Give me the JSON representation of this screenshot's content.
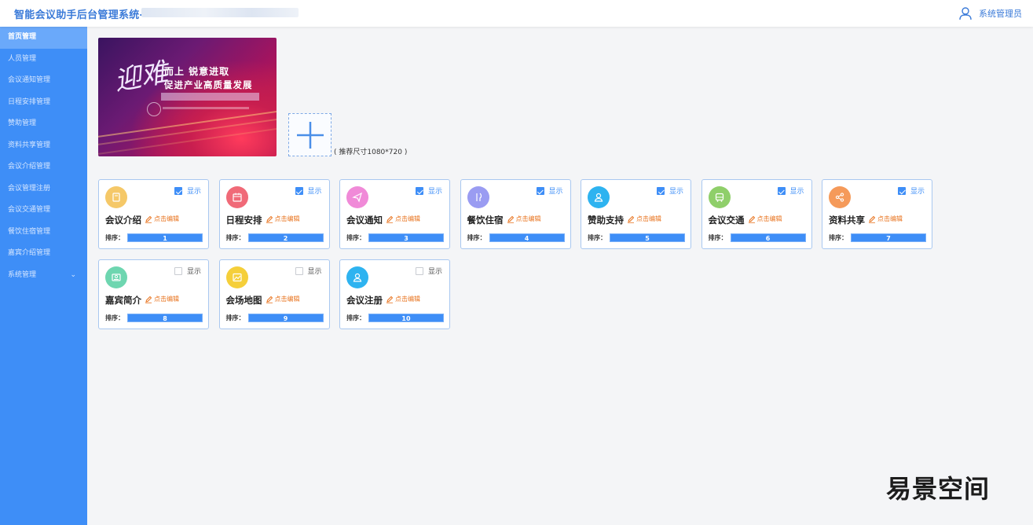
{
  "header": {
    "app_title": "智能会议助手后台管理系统---",
    "user_name": "系统管理员"
  },
  "sidebar": {
    "items": [
      {
        "label": "首页管理",
        "active": true
      },
      {
        "label": "人员管理"
      },
      {
        "label": "会议通知管理"
      },
      {
        "label": "日程安排管理"
      },
      {
        "label": "赞助管理"
      },
      {
        "label": "资料共享管理"
      },
      {
        "label": "会议介绍管理"
      },
      {
        "label": "会议管理注册"
      },
      {
        "label": "会议交通管理"
      },
      {
        "label": "餐饮住宿管理"
      },
      {
        "label": "嘉宾介绍管理"
      },
      {
        "label": "系统管理",
        "has_children": true
      }
    ]
  },
  "banner": {
    "big_char": "迎难",
    "line1": "而上  锐意进取",
    "line2": "促进产业高质量发展"
  },
  "upload": {
    "hint": "( 推荐尺寸1080*720 )"
  },
  "cards": [
    {
      "title": "会议介绍",
      "show_label": "显示",
      "checked": true,
      "edit_label": "点击编辑",
      "sort_label": "排序：",
      "sort": "1",
      "icon": "book-icon",
      "color": "#f5c868"
    },
    {
      "title": "日程安排",
      "show_label": "显示",
      "checked": true,
      "edit_label": "点击编辑",
      "sort_label": "排序：",
      "sort": "2",
      "icon": "calendar-icon",
      "color": "#f06a78"
    },
    {
      "title": "会议通知",
      "show_label": "显示",
      "checked": true,
      "edit_label": "点击编辑",
      "sort_label": "排序：",
      "sort": "3",
      "icon": "send-icon",
      "color": "#f08ad8"
    },
    {
      "title": "餐饮住宿",
      "show_label": "显示",
      "checked": true,
      "edit_label": "点击编辑",
      "sort_label": "排序：",
      "sort": "4",
      "icon": "cutlery-icon",
      "color": "#9a9cf2"
    },
    {
      "title": "赞助支持",
      "show_label": "显示",
      "checked": true,
      "edit_label": "点击编辑",
      "sort_label": "排序：",
      "sort": "5",
      "icon": "person-icon",
      "color": "#2eb3f0"
    },
    {
      "title": "会议交通",
      "show_label": "显示",
      "checked": true,
      "edit_label": "点击编辑",
      "sort_label": "排序：",
      "sort": "6",
      "icon": "bus-icon",
      "color": "#8fcf6a"
    },
    {
      "title": "资料共享",
      "show_label": "显示",
      "checked": true,
      "edit_label": "点击编辑",
      "sort_label": "排序：",
      "sort": "7",
      "icon": "share-icon",
      "color": "#f59a5a"
    },
    {
      "title": "嘉宾简介",
      "show_label": "显示",
      "checked": false,
      "edit_label": "点击编辑",
      "sort_label": "排序：",
      "sort": "8",
      "icon": "profile-icon",
      "color": "#6ed6b0"
    },
    {
      "title": "会场地图",
      "show_label": "显示",
      "checked": false,
      "edit_label": "点击编辑",
      "sort_label": "排序：",
      "sort": "9",
      "icon": "map-icon",
      "color": "#f5cf3a"
    },
    {
      "title": "会议注册",
      "show_label": "显示",
      "checked": false,
      "edit_label": "点击编辑",
      "sort_label": "排序：",
      "sort": "10",
      "icon": "user-add-icon",
      "color": "#2eb3f0"
    }
  ],
  "watermark": "易景空间"
}
